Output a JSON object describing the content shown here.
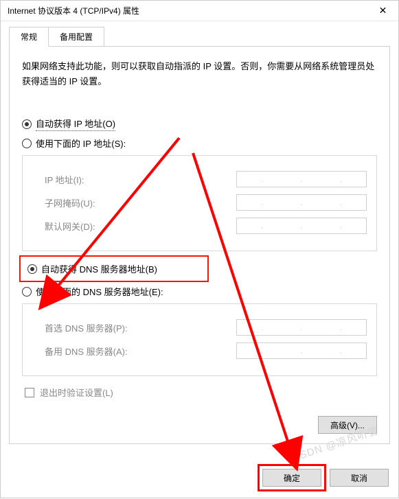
{
  "window": {
    "title": "Internet 协议版本 4 (TCP/IPv4) 属性",
    "close_glyph": "✕"
  },
  "tabs": {
    "general": "常规",
    "alternate": "备用配置"
  },
  "description": "如果网络支持此功能，则可以获取自动指派的 IP 设置。否则，你需要从网络系统管理员处获得适当的 IP 设置。",
  "ip_section": {
    "auto_label": "自动获得 IP 地址(O)",
    "manual_label": "使用下面的 IP 地址(S):",
    "ip_address_label": "IP 地址(I):",
    "subnet_label": "子网掩码(U):",
    "gateway_label": "默认网关(D):"
  },
  "dns_section": {
    "auto_label": "自动获得 DNS 服务器地址(B)",
    "manual_label": "使用下面的 DNS 服务器地址(E):",
    "preferred_label": "首选 DNS 服务器(P):",
    "alternate_label": "备用 DNS 服务器(A):"
  },
  "validate_label": "退出时验证设置(L)",
  "buttons": {
    "advanced": "高级(V)...",
    "ok": "确定",
    "cancel": "取消"
  },
  "watermark": "CSDN @凉风听雪",
  "colors": {
    "annotation_red": "#f00"
  }
}
